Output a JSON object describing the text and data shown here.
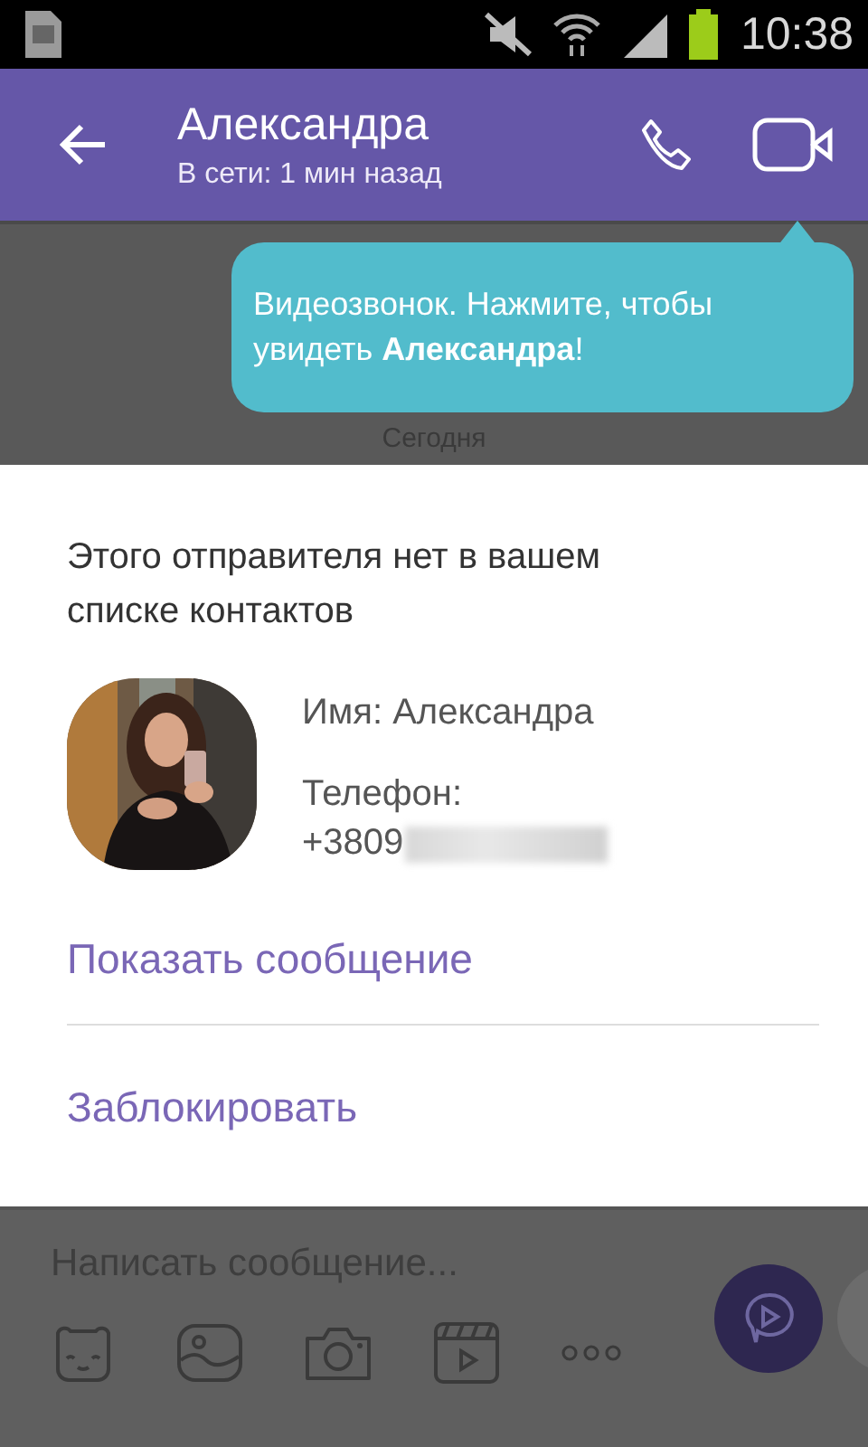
{
  "status_bar": {
    "time": "10:38"
  },
  "header": {
    "title": "Александра",
    "subtitle": "В сети: 1 мин назад"
  },
  "tooltip": {
    "text": "Видеозвонок. Нажмите, чтобы увидеть **Александра**!"
  },
  "chat": {
    "date_separator": "Сегодня"
  },
  "dialog": {
    "message": "Этого отправителя нет в вашем списке контактов",
    "name": "Имя: Александра",
    "phone_label": "Телефон:",
    "phone": "+3809",
    "phone_blurred": true,
    "actions": [
      "Показать сообщение",
      "Заблокировать"
    ]
  },
  "composer": {
    "placeholder": "Написать сообщение..."
  }
}
